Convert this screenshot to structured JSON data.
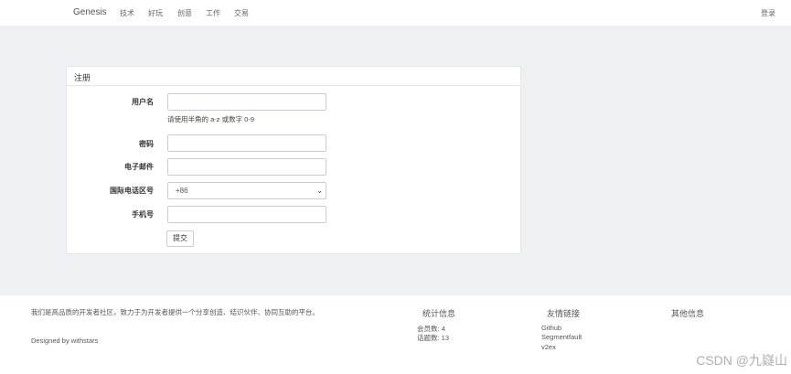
{
  "navbar": {
    "brand": "Genesis",
    "items": [
      "技术",
      "好玩",
      "创意",
      "工作",
      "交易"
    ],
    "login": "登录"
  },
  "form": {
    "title": "注册",
    "username_label": "用户名",
    "username_help": "请使用半角的 a-z 或数字 0-9",
    "password_label": "密码",
    "email_label": "电子邮件",
    "country_code_label": "国际电话区号",
    "country_code_value": "+86",
    "phone_label": "手机号",
    "submit_label": "提交"
  },
  "footer": {
    "description": "我们是高品质的开发者社区，致力于为开发者提供一个分享创造、结识伙伴、协同互助的平台。",
    "designed_by": "Designed by withstars",
    "stats_title": "统计信息",
    "stats": [
      "会员数: 4",
      "话题数: 13"
    ],
    "links_title": "友情链接",
    "links": [
      "Github",
      "Segmentfault",
      "v2ex"
    ],
    "other_title": "其他信息"
  },
  "watermark": "CSDN @九嶷山"
}
